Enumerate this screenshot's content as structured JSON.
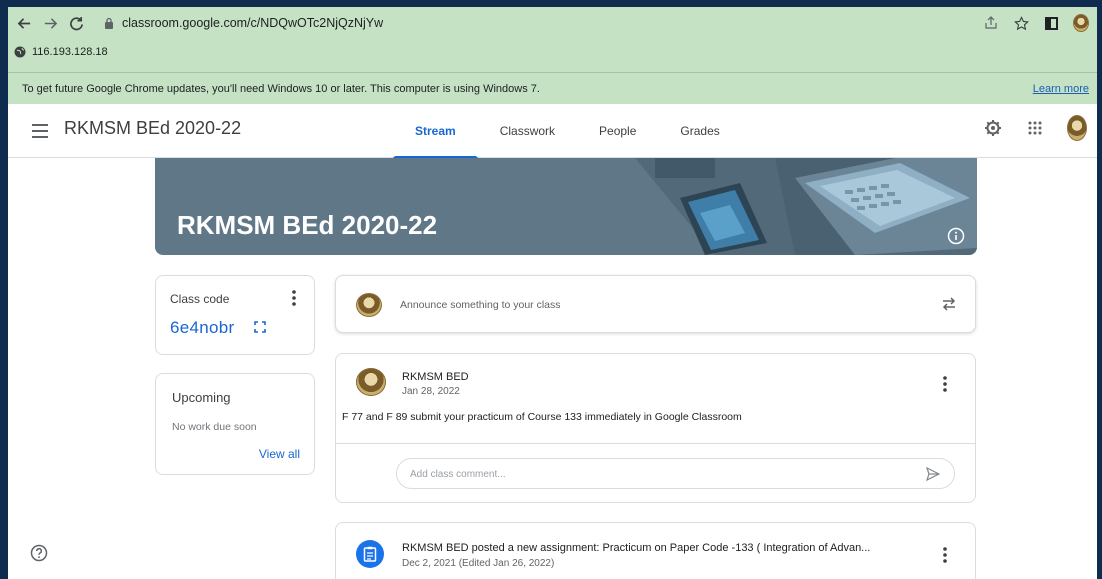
{
  "browser": {
    "url": "classroom.google.com/c/NDQwOTc2NjQzNjYw",
    "ip": "116.193.128.18",
    "info_message": "To get future Google Chrome updates, you'll need Windows 10 or later. This computer is using Windows 7.",
    "learn_more": "Learn more"
  },
  "header": {
    "class_name": "RKMSM BEd 2020-22",
    "tabs": [
      {
        "label": "Stream",
        "active": true
      },
      {
        "label": "Classwork",
        "active": false
      },
      {
        "label": "People",
        "active": false
      },
      {
        "label": "Grades",
        "active": false
      }
    ]
  },
  "banner": {
    "title": "RKMSM BEd 2020-22"
  },
  "class_code": {
    "label": "Class code",
    "value": "6e4nobr"
  },
  "upcoming": {
    "title": "Upcoming",
    "status": "No work due soon",
    "view_all": "View all"
  },
  "announce": {
    "placeholder": "Announce something to your class"
  },
  "post": {
    "author": "RKMSM BED",
    "date": "Jan 28, 2022",
    "body": "F 77 and F 89 submit your practicum of Course 133 immediately in Google Classroom",
    "comment_placeholder": "Add class comment..."
  },
  "assignment": {
    "title": "RKMSM BED posted a new assignment: Practicum on Paper Code -133 ( Integration of Advan...",
    "date": "Dec 2, 2021 (Edited Jan 26, 2022)"
  },
  "colors": {
    "chrome_bg": "#c5e2c4",
    "accent": "#1967d2",
    "banner": "#5f7786"
  }
}
